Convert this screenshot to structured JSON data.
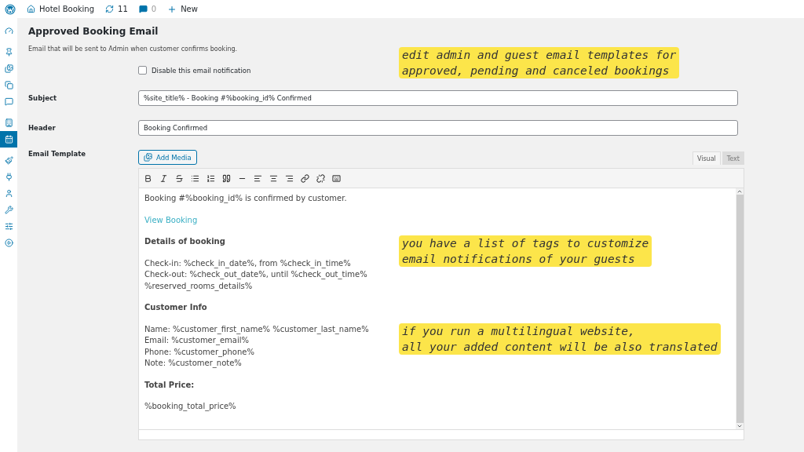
{
  "admin_bar": {
    "site": "Hotel Booking",
    "updates": "11",
    "comments": "0",
    "new": "New"
  },
  "sidebar": {
    "items": [
      {
        "selected": false
      },
      {
        "selected": false
      },
      {
        "selected": false
      },
      {
        "selected": false
      },
      {
        "selected": false
      },
      {
        "selected": false
      },
      {
        "selected": true
      },
      {
        "selected": false
      },
      {
        "selected": false
      },
      {
        "selected": false
      },
      {
        "selected": false
      },
      {
        "selected": false
      },
      {
        "selected": false
      }
    ]
  },
  "page": {
    "title": "Approved Booking Email",
    "description": "Email that will be sent to Admin when customer confirms booking.",
    "disable_checkbox": {
      "label": "Disable this email notification",
      "checked": false
    },
    "fields": [
      {
        "label": "Subject",
        "value": "%site_title% - Booking #%booking_id% Confirmed"
      },
      {
        "label": "Header",
        "value": "Booking Confirmed"
      }
    ],
    "email_template": {
      "label": "Email Template",
      "add_media": "Add Media",
      "tabs": [
        {
          "label": "Visual",
          "selected": true
        },
        {
          "label": "Text",
          "selected": false
        }
      ],
      "content": [
        {
          "kind": "paragraph",
          "lines": [
            "Booking #%booking_id% is confirmed by customer."
          ]
        },
        {
          "kind": "link",
          "lines": [
            "View Booking"
          ]
        },
        {
          "kind": "heading",
          "lines": [
            "Details of booking"
          ]
        },
        {
          "kind": "paragraph",
          "lines": [
            "Check-in: %check_in_date%, from %check_in_time%",
            "Check-out: %check_out_date%, until %check_out_time%",
            "%reserved_rooms_details%"
          ]
        },
        {
          "kind": "heading",
          "lines": [
            "Customer Info"
          ]
        },
        {
          "kind": "paragraph",
          "lines": [
            "Name: %customer_first_name% %customer_last_name%",
            "Email: %customer_email%",
            "Phone: %customer_phone%",
            "Note: %customer_note%"
          ]
        },
        {
          "kind": "heading",
          "lines": [
            "Total Price:"
          ]
        },
        {
          "kind": "paragraph",
          "lines": [
            "%booking_total_price%"
          ]
        }
      ]
    }
  },
  "annotations": [
    {
      "text": "edit admin and guest email templates for\napproved, pending and canceled bookings"
    },
    {
      "text": "you have a list of tags to customize\nemail notifications of your guests"
    },
    {
      "text": "if you run a multilingual website,\nall your added content will be also translated"
    }
  ]
}
